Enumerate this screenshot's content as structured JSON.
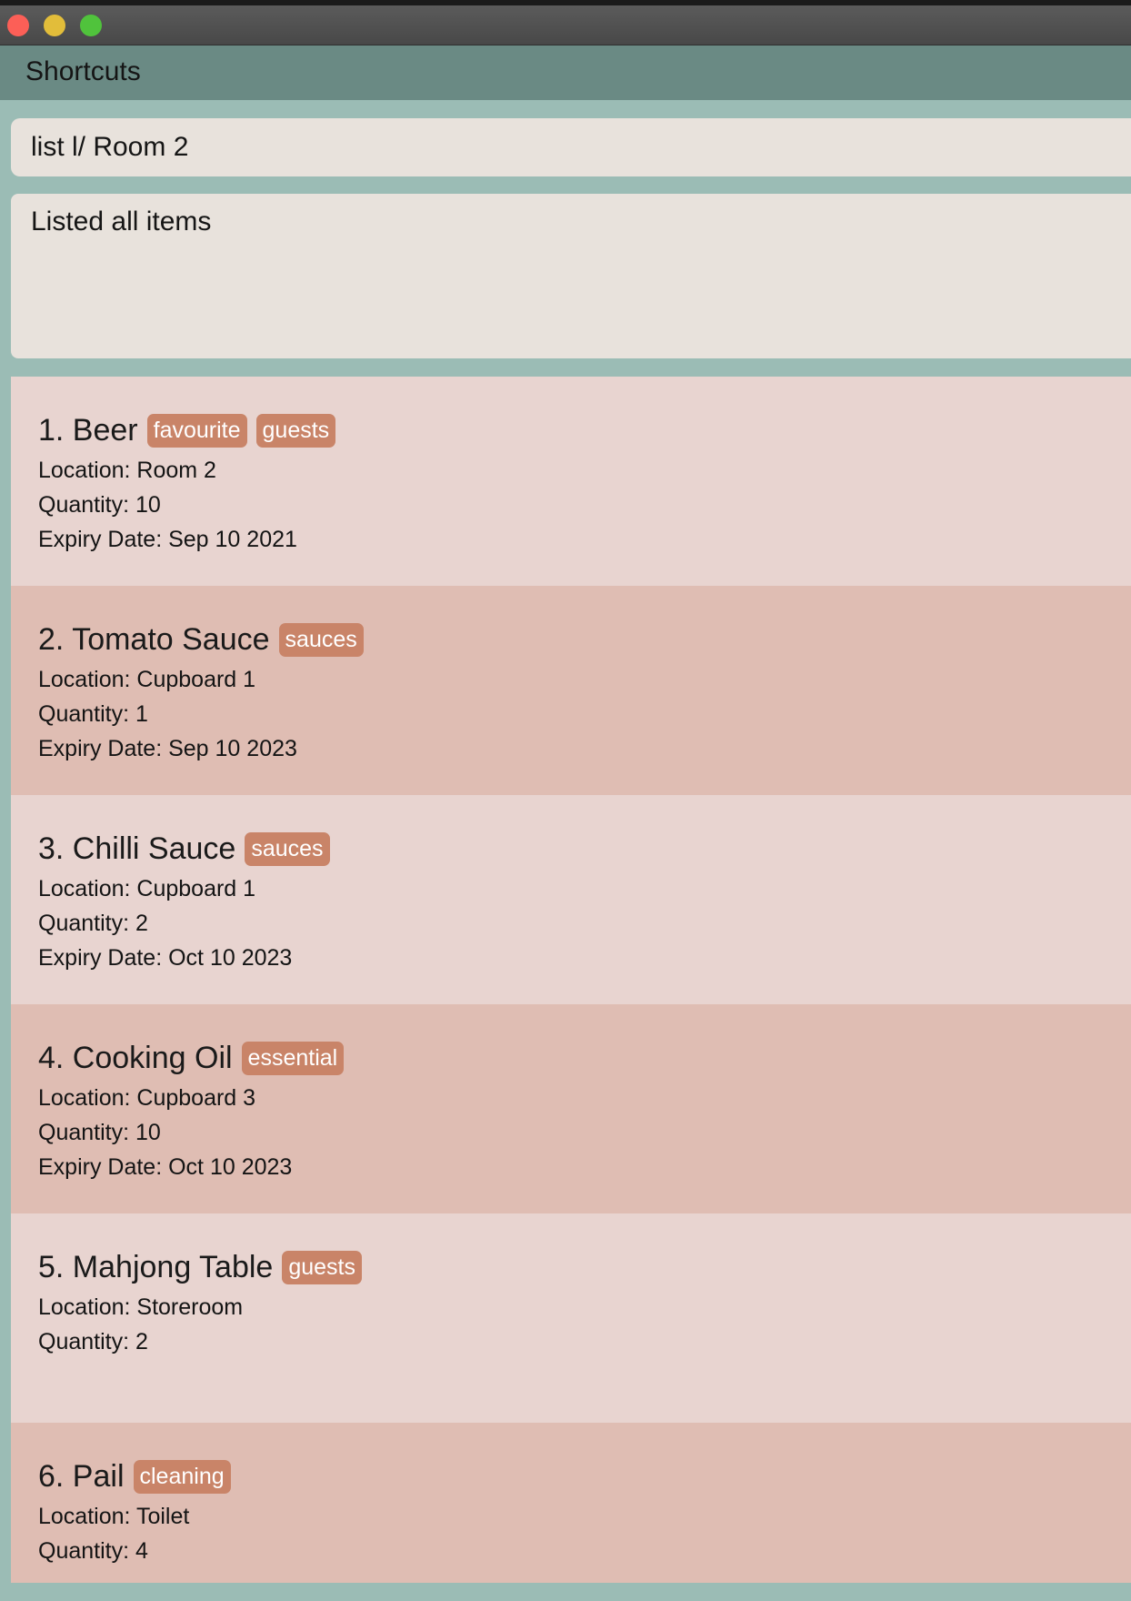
{
  "window": {
    "controls": [
      "close",
      "minimize",
      "zoom"
    ]
  },
  "menubar": {
    "items": [
      "Shortcuts"
    ]
  },
  "command": {
    "value": "list l/ Room 2"
  },
  "result": {
    "message": "Listed all items"
  },
  "items": [
    {
      "index": "1.",
      "name": "Beer",
      "tags": [
        "favourite",
        "guests"
      ],
      "location": "Location: Room 2",
      "quantity": "Quantity: 10",
      "expiry": "Expiry Date: Sep 10 2021"
    },
    {
      "index": "2.",
      "name": "Tomato Sauce",
      "tags": [
        "sauces"
      ],
      "location": "Location: Cupboard 1",
      "quantity": "Quantity: 1",
      "expiry": "Expiry Date: Sep 10 2023"
    },
    {
      "index": "3.",
      "name": "Chilli Sauce",
      "tags": [
        "sauces"
      ],
      "location": "Location: Cupboard 1",
      "quantity": "Quantity: 2",
      "expiry": "Expiry Date: Oct 10 2023"
    },
    {
      "index": "4.",
      "name": "Cooking Oil",
      "tags": [
        "essential"
      ],
      "location": "Location: Cupboard 3",
      "quantity": "Quantity: 10",
      "expiry": "Expiry Date: Oct 10 2023"
    },
    {
      "index": "5.",
      "name": "Mahjong Table",
      "tags": [
        "guests"
      ],
      "location": "Location: Storeroom",
      "quantity": "Quantity: 2",
      "expiry": ""
    },
    {
      "index": "6.",
      "name": "Pail",
      "tags": [
        "cleaning"
      ],
      "location": "Location: Toilet",
      "quantity": "Quantity: 4",
      "expiry": ""
    }
  ],
  "colors": {
    "background": "#9bbcb5",
    "menubar": "#6a8a84",
    "card_odd": "#e8d4d0",
    "card_even": "#dfbdb3",
    "tag": "#c98468",
    "input": "#e8e2dc"
  }
}
